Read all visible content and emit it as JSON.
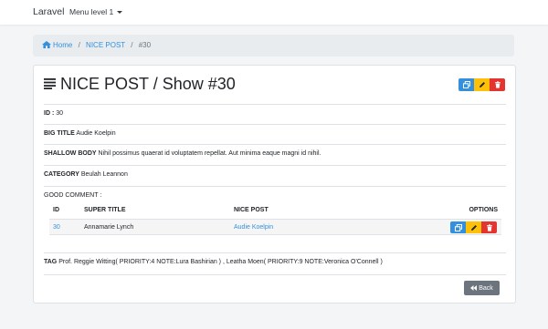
{
  "navbar": {
    "brand": "Laravel",
    "menu_label": "Menu level 1"
  },
  "breadcrumb": {
    "items": [
      "Home",
      "NICE POST",
      "#30"
    ]
  },
  "card": {
    "title": "NICE POST / Show #30",
    "fields": {
      "id_label": "ID",
      "id_sep": ":",
      "id_value": "30",
      "big_title_label": "BIG TITLE",
      "big_title_value": "Audie Koelpin",
      "shallow_body_label": "SHALLOW BODY",
      "shallow_body_value": "Nihil possimus quaerat id voluptatem repellat. Aut minima eaque magni id nihil.",
      "category_label": "CATEGORY",
      "category_value": "Beulah Leannon",
      "good_comment_label": "GOOD COMMENT",
      "tag_label": "TAG",
      "tag_value": "Prof. Reggie Witting( PRIORITY:4 NOTE:Lura Bashirian ) ,  Leatha Moen( PRIORITY:9 NOTE:Veronica O'Connell )"
    },
    "table": {
      "headers": [
        "ID",
        "SUPER TITLE",
        "NICE POST",
        "OPTIONS"
      ],
      "rows": [
        {
          "id": "30",
          "super_title": "Annamarie Lynch",
          "nice_post": "Audie Koelpin"
        }
      ]
    },
    "back_label": "Back"
  },
  "colors": {
    "primary": "#3490dc",
    "warning": "#ffc107",
    "danger": "#e3342f",
    "secondary": "#6c757d"
  }
}
